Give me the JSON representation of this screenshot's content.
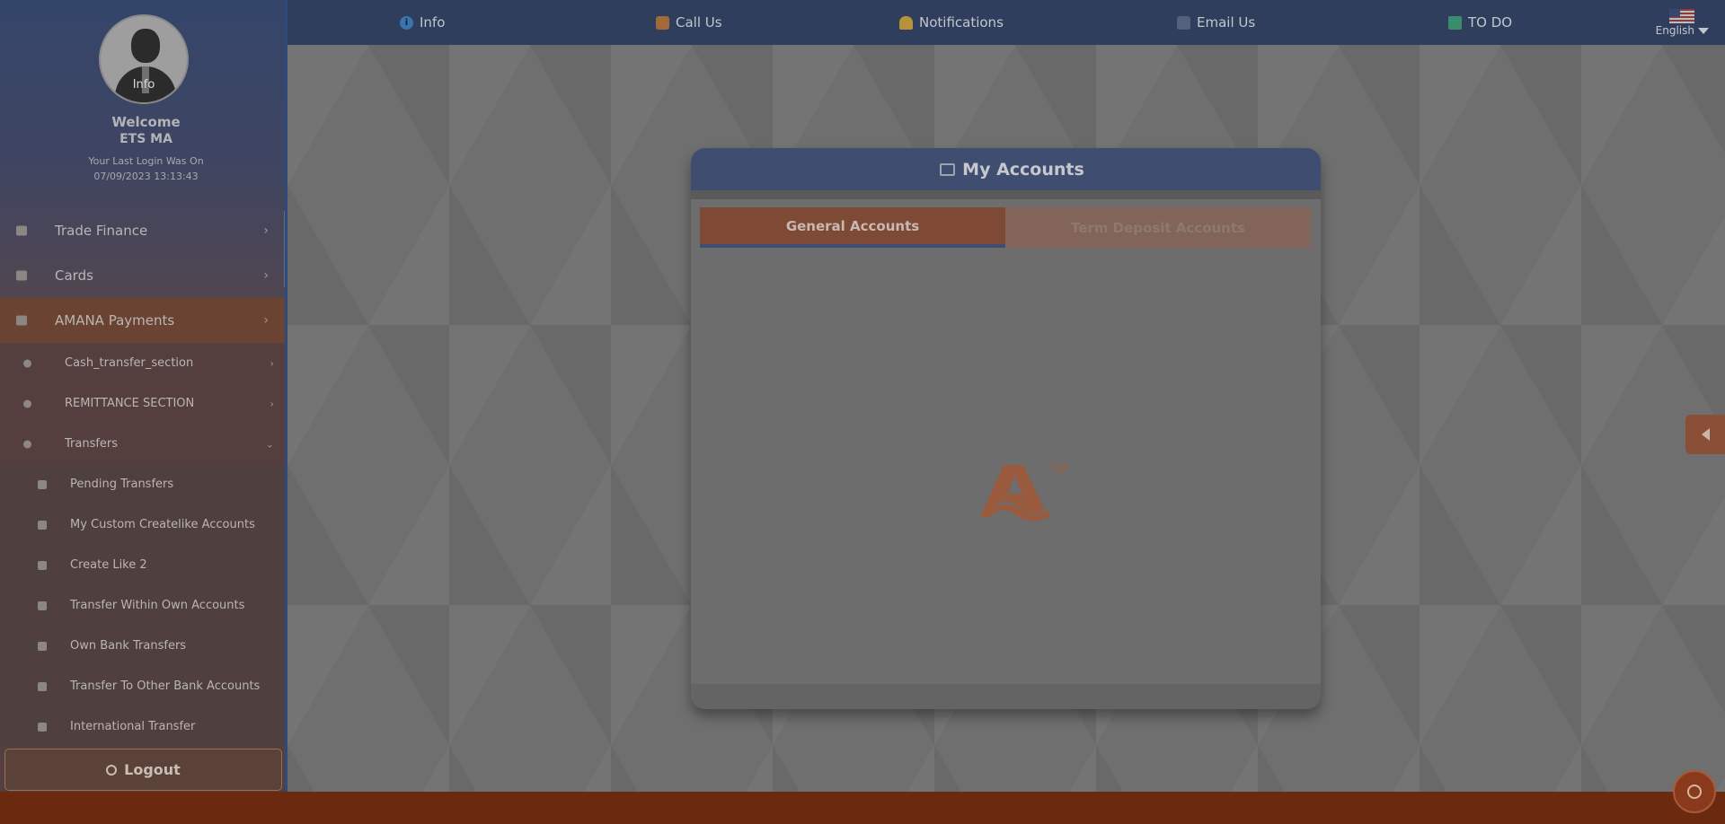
{
  "topnav": {
    "items": [
      {
        "label": "Info",
        "icon": "info-icon"
      },
      {
        "label": "Call Us",
        "icon": "phone-icon"
      },
      {
        "label": "Notifications",
        "icon": "bell-icon"
      },
      {
        "label": "Email Us",
        "icon": "email-icon"
      },
      {
        "label": "TO DO",
        "icon": "todo-icon"
      }
    ],
    "language": "English"
  },
  "sidebar": {
    "avatar_label": "Info",
    "welcome": "Welcome",
    "username": "ETS MA",
    "last_login_label": "Your Last Login Was On",
    "last_login_value": "07/09/2023 13:13:43",
    "menu": [
      {
        "label": "Trade Finance",
        "level": 1,
        "icon": "trade-finance-icon",
        "chevron": "›"
      },
      {
        "label": "Cards",
        "level": 1,
        "icon": "card-icon",
        "chevron": "›"
      },
      {
        "label": "AMANA Payments",
        "level": 1,
        "icon": "payments-icon",
        "chevron": "›"
      },
      {
        "label": "Cash_transfer_section",
        "level": 2,
        "icon": "question-icon",
        "chevron": "›"
      },
      {
        "label": "REMITTANCE SECTION",
        "level": 2,
        "icon": "question-icon",
        "chevron": "›"
      },
      {
        "label": "Transfers",
        "level": 2,
        "icon": "transfer-icon",
        "chevron": "⌄"
      },
      {
        "label": "Pending Transfers",
        "level": 3,
        "icon": "list-icon"
      },
      {
        "label": "My Custom Createlike Accounts",
        "level": 3,
        "icon": "question-icon"
      },
      {
        "label": "Create Like 2",
        "level": 3,
        "icon": "question-icon"
      },
      {
        "label": "Transfer Within Own Accounts",
        "level": 3,
        "icon": "accounts-icon"
      },
      {
        "label": "Own Bank Transfers",
        "level": 3,
        "icon": "bank-icon"
      },
      {
        "label": "Transfer To Other Bank Accounts",
        "level": 3,
        "icon": "chart-icon"
      },
      {
        "label": "International Transfer",
        "level": 3,
        "icon": "globe-icon"
      }
    ],
    "logout": "Logout"
  },
  "panel": {
    "title": "My Accounts",
    "tabs": [
      {
        "label": "General Accounts",
        "active": true
      },
      {
        "label": "Term Deposit Accounts",
        "active": false
      }
    ],
    "logo_tm": "TM"
  },
  "colors": {
    "topbar": "#2f3e5c",
    "accent_orange": "#7e4a36",
    "footer": "#6b2a0f"
  }
}
